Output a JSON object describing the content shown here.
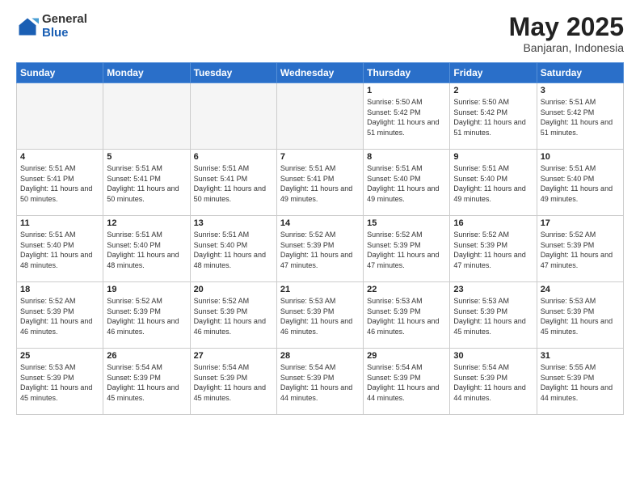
{
  "logo": {
    "general": "General",
    "blue": "Blue"
  },
  "header": {
    "month": "May 2025",
    "location": "Banjaran, Indonesia"
  },
  "weekdays": [
    "Sunday",
    "Monday",
    "Tuesday",
    "Wednesday",
    "Thursday",
    "Friday",
    "Saturday"
  ],
  "weeks": [
    [
      {
        "day": "",
        "info": ""
      },
      {
        "day": "",
        "info": ""
      },
      {
        "day": "",
        "info": ""
      },
      {
        "day": "",
        "info": ""
      },
      {
        "day": "1",
        "info": "Sunrise: 5:50 AM\nSunset: 5:42 PM\nDaylight: 11 hours and 51 minutes."
      },
      {
        "day": "2",
        "info": "Sunrise: 5:50 AM\nSunset: 5:42 PM\nDaylight: 11 hours and 51 minutes."
      },
      {
        "day": "3",
        "info": "Sunrise: 5:51 AM\nSunset: 5:42 PM\nDaylight: 11 hours and 51 minutes."
      }
    ],
    [
      {
        "day": "4",
        "info": "Sunrise: 5:51 AM\nSunset: 5:41 PM\nDaylight: 11 hours and 50 minutes."
      },
      {
        "day": "5",
        "info": "Sunrise: 5:51 AM\nSunset: 5:41 PM\nDaylight: 11 hours and 50 minutes."
      },
      {
        "day": "6",
        "info": "Sunrise: 5:51 AM\nSunset: 5:41 PM\nDaylight: 11 hours and 50 minutes."
      },
      {
        "day": "7",
        "info": "Sunrise: 5:51 AM\nSunset: 5:41 PM\nDaylight: 11 hours and 49 minutes."
      },
      {
        "day": "8",
        "info": "Sunrise: 5:51 AM\nSunset: 5:40 PM\nDaylight: 11 hours and 49 minutes."
      },
      {
        "day": "9",
        "info": "Sunrise: 5:51 AM\nSunset: 5:40 PM\nDaylight: 11 hours and 49 minutes."
      },
      {
        "day": "10",
        "info": "Sunrise: 5:51 AM\nSunset: 5:40 PM\nDaylight: 11 hours and 49 minutes."
      }
    ],
    [
      {
        "day": "11",
        "info": "Sunrise: 5:51 AM\nSunset: 5:40 PM\nDaylight: 11 hours and 48 minutes."
      },
      {
        "day": "12",
        "info": "Sunrise: 5:51 AM\nSunset: 5:40 PM\nDaylight: 11 hours and 48 minutes."
      },
      {
        "day": "13",
        "info": "Sunrise: 5:51 AM\nSunset: 5:40 PM\nDaylight: 11 hours and 48 minutes."
      },
      {
        "day": "14",
        "info": "Sunrise: 5:52 AM\nSunset: 5:39 PM\nDaylight: 11 hours and 47 minutes."
      },
      {
        "day": "15",
        "info": "Sunrise: 5:52 AM\nSunset: 5:39 PM\nDaylight: 11 hours and 47 minutes."
      },
      {
        "day": "16",
        "info": "Sunrise: 5:52 AM\nSunset: 5:39 PM\nDaylight: 11 hours and 47 minutes."
      },
      {
        "day": "17",
        "info": "Sunrise: 5:52 AM\nSunset: 5:39 PM\nDaylight: 11 hours and 47 minutes."
      }
    ],
    [
      {
        "day": "18",
        "info": "Sunrise: 5:52 AM\nSunset: 5:39 PM\nDaylight: 11 hours and 46 minutes."
      },
      {
        "day": "19",
        "info": "Sunrise: 5:52 AM\nSunset: 5:39 PM\nDaylight: 11 hours and 46 minutes."
      },
      {
        "day": "20",
        "info": "Sunrise: 5:52 AM\nSunset: 5:39 PM\nDaylight: 11 hours and 46 minutes."
      },
      {
        "day": "21",
        "info": "Sunrise: 5:53 AM\nSunset: 5:39 PM\nDaylight: 11 hours and 46 minutes."
      },
      {
        "day": "22",
        "info": "Sunrise: 5:53 AM\nSunset: 5:39 PM\nDaylight: 11 hours and 46 minutes."
      },
      {
        "day": "23",
        "info": "Sunrise: 5:53 AM\nSunset: 5:39 PM\nDaylight: 11 hours and 45 minutes."
      },
      {
        "day": "24",
        "info": "Sunrise: 5:53 AM\nSunset: 5:39 PM\nDaylight: 11 hours and 45 minutes."
      }
    ],
    [
      {
        "day": "25",
        "info": "Sunrise: 5:53 AM\nSunset: 5:39 PM\nDaylight: 11 hours and 45 minutes."
      },
      {
        "day": "26",
        "info": "Sunrise: 5:54 AM\nSunset: 5:39 PM\nDaylight: 11 hours and 45 minutes."
      },
      {
        "day": "27",
        "info": "Sunrise: 5:54 AM\nSunset: 5:39 PM\nDaylight: 11 hours and 45 minutes."
      },
      {
        "day": "28",
        "info": "Sunrise: 5:54 AM\nSunset: 5:39 PM\nDaylight: 11 hours and 44 minutes."
      },
      {
        "day": "29",
        "info": "Sunrise: 5:54 AM\nSunset: 5:39 PM\nDaylight: 11 hours and 44 minutes."
      },
      {
        "day": "30",
        "info": "Sunrise: 5:54 AM\nSunset: 5:39 PM\nDaylight: 11 hours and 44 minutes."
      },
      {
        "day": "31",
        "info": "Sunrise: 5:55 AM\nSunset: 5:39 PM\nDaylight: 11 hours and 44 minutes."
      }
    ]
  ]
}
